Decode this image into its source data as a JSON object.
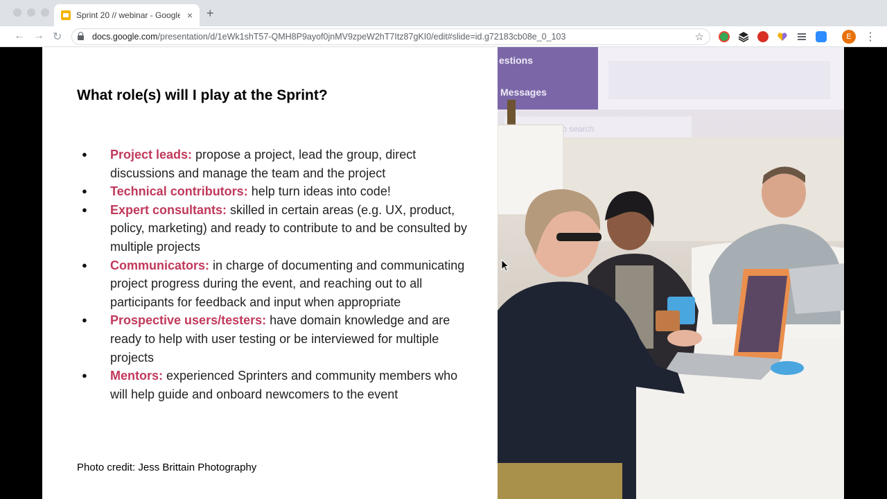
{
  "browser": {
    "tab_title": "Sprint 20 // webinar - Google Sl",
    "tab_close": "×",
    "new_tab": "+",
    "url_host": "docs.google.com",
    "url_path": "/presentation/d/1eWk1shT57-QMH8P9ayof0jnMV9zpeW2hT7Itz87gKI0/edit#slide=id.g72183cb08e_0_103",
    "profile_initial": "E",
    "back": "←",
    "forward": "→",
    "reload": "↻",
    "star": "☆",
    "menu": "⋮"
  },
  "slide": {
    "title": "What role(s) will I play at the Sprint?",
    "roles": [
      {
        "term": "Project leads:",
        "text": " propose a project, lead the group, direct discussions and manage the team and the project"
      },
      {
        "term": "Technical contributors:",
        "text": " help turn ideas into code!"
      },
      {
        "term": "Expert consultants:",
        "text": " skilled in certain areas (e.g. UX, product, policy, marketing) and ready to contribute to and be consulted by multiple projects"
      },
      {
        "term": "Communicators:",
        "text": " in charge of documenting and communicating project progress during the event, and reaching out to all participants for feedback and input when appropriate"
      },
      {
        "term": "Prospective users/testers:",
        "text": " have domain knowledge and are ready to help with user testing or be interviewed for multiple projects"
      },
      {
        "term": "Mentors:",
        "text": " experienced Sprinters and community members who will help guide and onboard newcomers to the event"
      }
    ],
    "credit": "Photo credit: Jess Brittain Photography"
  },
  "photo_screen": {
    "line1": "estions",
    "line2": "Messages",
    "line3": "to search"
  },
  "colors": {
    "accent_term": "#c0395a",
    "tab_strip": "#dee1e6",
    "favicon": "#f4b400"
  }
}
